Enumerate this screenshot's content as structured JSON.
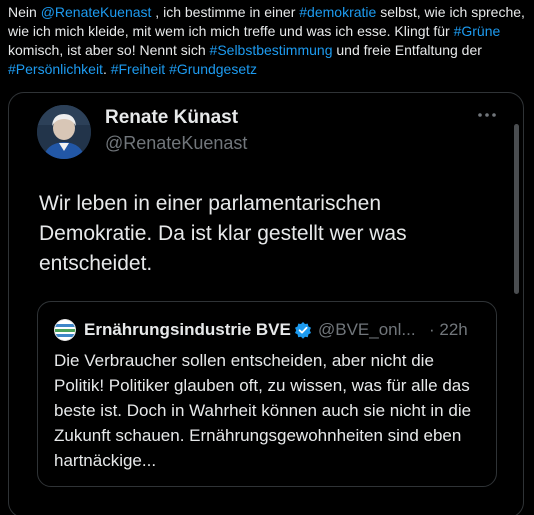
{
  "post": {
    "segments": [
      {
        "text": "Nein ",
        "link": false
      },
      {
        "text": "@RenateKuenast",
        "link": true
      },
      {
        "text": " , ich bestimme in einer ",
        "link": false
      },
      {
        "text": "#demokratie",
        "link": true
      },
      {
        "text": " selbst, wie ich spreche, wie ich mich kleide, mit wem ich mich treffe und was ich esse. Klingt für ",
        "link": false
      },
      {
        "text": "#Grüne",
        "link": true
      },
      {
        "text": " komisch, ist aber so! Nennt sich ",
        "link": false
      },
      {
        "text": "#Selbstbestimmung",
        "link": true
      },
      {
        "text": " und freie Entfaltung der ",
        "link": false
      },
      {
        "text": "#Persönlichkeit",
        "link": true
      },
      {
        "text": ". ",
        "link": false
      },
      {
        "text": "#Freiheit",
        "link": true
      },
      {
        "text": " ",
        "link": false
      },
      {
        "text": "#Grundgesetz",
        "link": true
      }
    ]
  },
  "screenshot": {
    "author": {
      "name": "Renate Künast",
      "handle": "@RenateKuenast",
      "avatar_icon": "profile-photo-icon"
    },
    "more_icon": "more-horizontal-icon",
    "body": "Wir leben in einer parlamentarischen Demokratie. Da ist klar gestellt wer was entscheidet.",
    "scroll_position_fraction": 0.05,
    "quote": {
      "avatar_icon": "bve-logo-icon",
      "name": "Ernährungsindustrie BVE",
      "verified_icon": "verified-badge-icon",
      "handle": "@BVE_onl...",
      "time": "· 22h",
      "body": "Die Verbraucher sollen entscheiden, aber nicht die Politik! Politiker glauben oft, zu wissen, was für alle das beste ist. Doch in Wahrheit können auch sie nicht in die Zukunft schauen. Ernährungsgewohnheiten sind eben hartnäckige..."
    }
  },
  "colors": {
    "background": "#000000",
    "text": "#e7e9ea",
    "link": "#1d9bf0",
    "muted": "#71767b",
    "border": "#2f3336",
    "verified": "#1d9bf0"
  }
}
